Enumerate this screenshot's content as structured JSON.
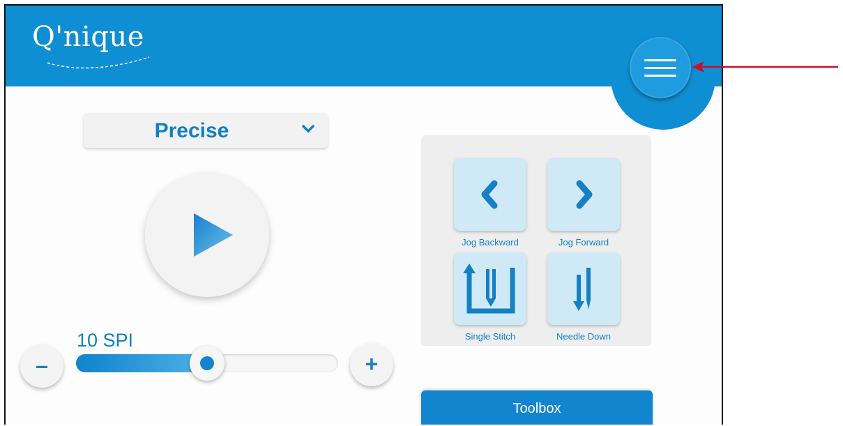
{
  "app": {
    "logo_text": "Q'nique"
  },
  "header": {
    "menu_icon": "hamburger-menu-icon"
  },
  "stitch_mode": {
    "selected": "Precise"
  },
  "speed": {
    "label": "10 SPI",
    "level": 0.5
  },
  "controls": {
    "jog_backward": "Jog Backward",
    "jog_forward": "Jog Forward",
    "single_stitch": "Single Stitch",
    "needle_down": "Needle Down"
  },
  "buttons": {
    "minus": "–",
    "plus": "+"
  },
  "toolbox": {
    "label": "Toolbox"
  },
  "colors": {
    "brand_blue": "#0f8fd3",
    "button_light_blue": "#cfe9f6",
    "annotation_red": "#c8102e"
  }
}
